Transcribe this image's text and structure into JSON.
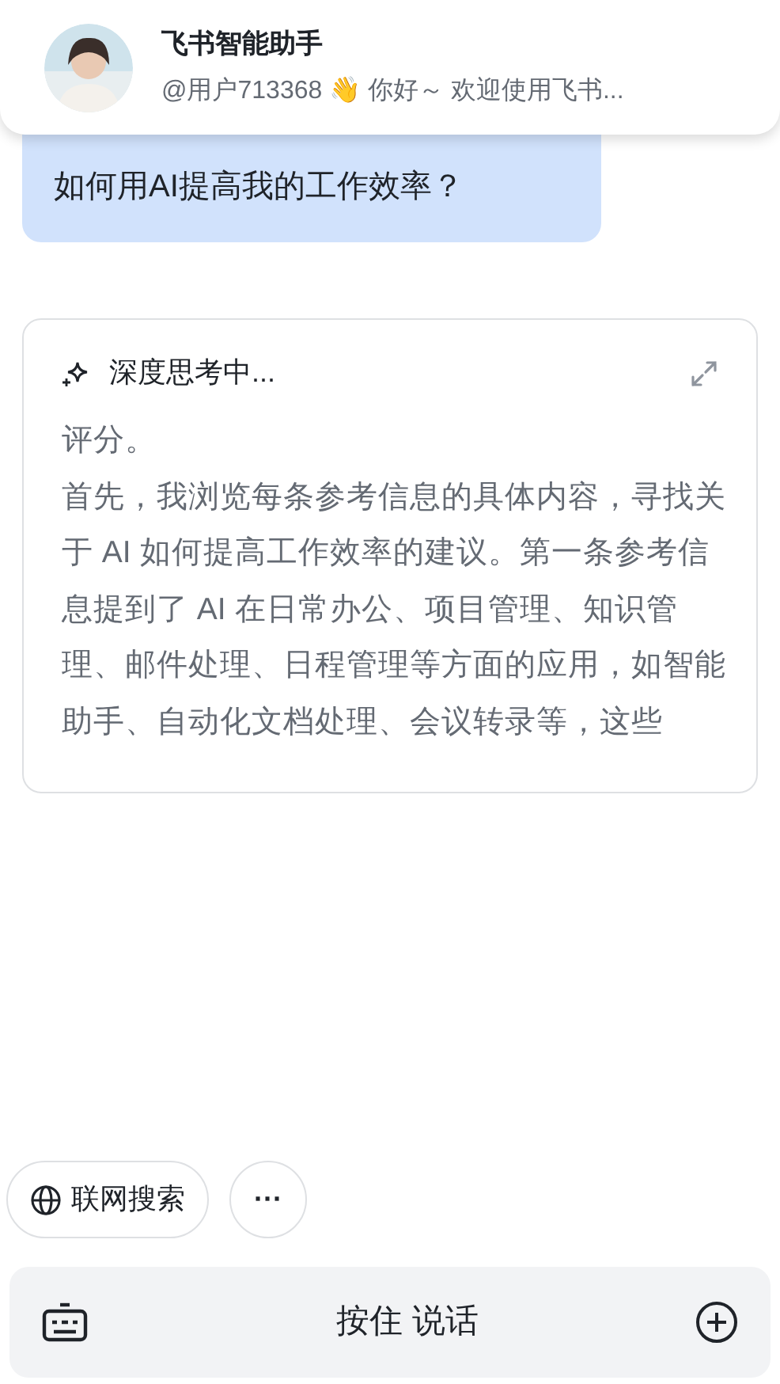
{
  "notification": {
    "title": "飞书智能助手",
    "message": "@用户713368 👋 你好～ 欢迎使用飞书..."
  },
  "user_message": "如何用AI提高我的工作效率？",
  "thinking": {
    "title": "深度思考中...",
    "paragraphs": [
      "评分。",
      "首先，我浏览每条参考信息的具体内容，寻找关于 AI 如何提高工作效率的建议。第一条参考信息提到了 AI 在日常办公、项目管理、知识管理、邮件处理、日程管理等方面的应用，如智能助手、自动化文档处理、会议转录等，这些"
    ]
  },
  "search_chip": {
    "label": "联网搜索"
  },
  "more_button": {
    "label": "···"
  },
  "input_bar": {
    "label": "按住 说话"
  }
}
